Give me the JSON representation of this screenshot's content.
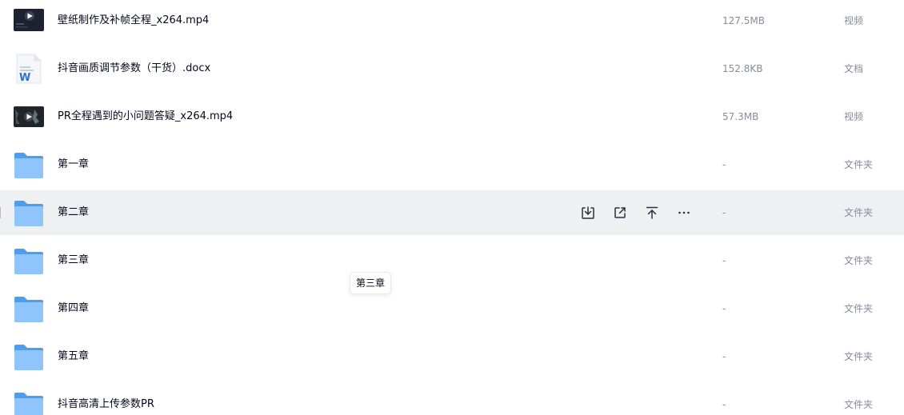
{
  "files": [
    {
      "name": "壁纸制作及补帧全程_x264.mp4",
      "size": "127.5MB",
      "type": "视频",
      "icon": "video-thumbnail-icon"
    },
    {
      "name": "抖音画质调节参数（干货）.docx",
      "size": "152.8KB",
      "type": "文档",
      "icon": "word-doc-icon"
    },
    {
      "name": "PR全程遇到的小问题答疑_x264.mp4",
      "size": "57.3MB",
      "type": "视频",
      "icon": "video-thumbnail-icon"
    },
    {
      "name": "第一章",
      "size": "-",
      "type": "文件夹",
      "icon": "folder-icon"
    },
    {
      "name": "第二章",
      "size": "-",
      "type": "文件夹",
      "icon": "folder-icon"
    },
    {
      "name": "第三章",
      "size": "-",
      "type": "文件夹",
      "icon": "folder-icon"
    },
    {
      "name": "第四章",
      "size": "-",
      "type": "文件夹",
      "icon": "folder-icon"
    },
    {
      "name": "第五章",
      "size": "-",
      "type": "文件夹",
      "icon": "folder-icon"
    },
    {
      "name": "抖音高清上传参数PR",
      "size": "-",
      "type": "文件夹",
      "icon": "folder-icon"
    }
  ],
  "hover_actions": [
    "download-icon",
    "share-icon",
    "move-to-top-icon",
    "more-icon"
  ],
  "tooltip": {
    "text": "第三章"
  },
  "colors": {
    "hover_row_bg": "#eff0f2",
    "folder_back": "#4d9eef",
    "folder_front": "#8fc5fb",
    "text_primary": "#03081a",
    "text_secondary": "#878c9c"
  }
}
